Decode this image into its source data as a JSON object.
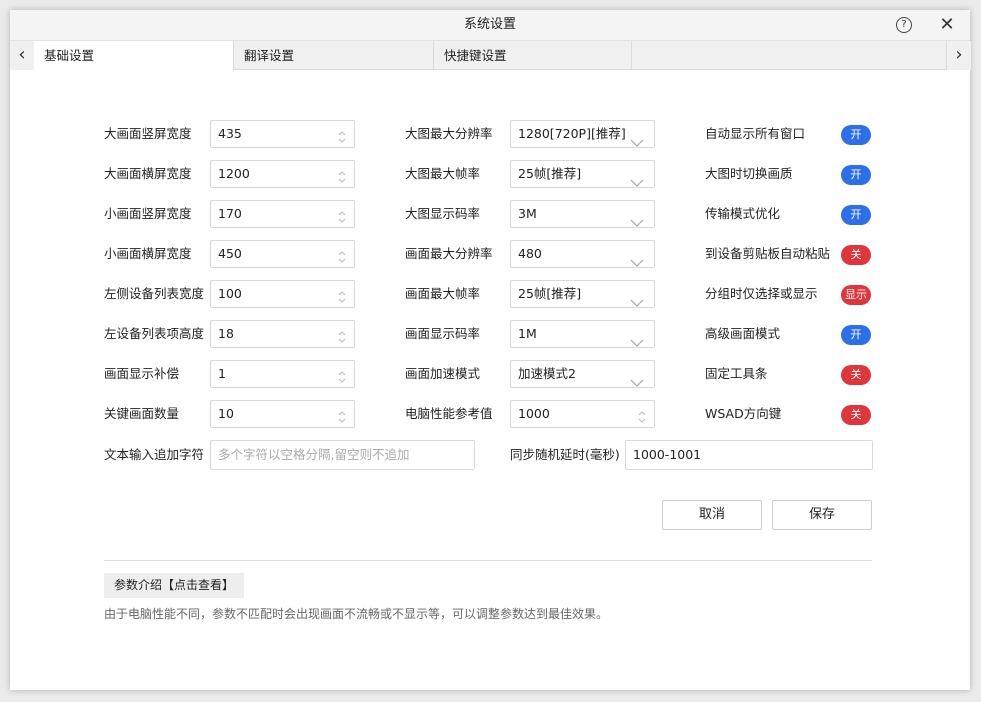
{
  "window": {
    "title": "系统设置",
    "help_label": "?",
    "close_label": "✕"
  },
  "tabs": {
    "prev_arrow": "‹",
    "next_arrow": "›",
    "items": [
      {
        "label": "基础设置",
        "active": true
      },
      {
        "label": "翻译设置",
        "active": false
      },
      {
        "label": "快捷键设置",
        "active": false
      }
    ]
  },
  "col1": [
    {
      "label": "大画面竖屏宽度",
      "value": "435"
    },
    {
      "label": "大画面横屏宽度",
      "value": "1200"
    },
    {
      "label": "小画面竖屏宽度",
      "value": "170"
    },
    {
      "label": "小画面横屏宽度",
      "value": "450"
    },
    {
      "label": "左侧设备列表宽度",
      "value": "100"
    },
    {
      "label": "左设备列表项高度",
      "value": "18"
    },
    {
      "label": "画面显示补偿",
      "value": "1"
    },
    {
      "label": "关键画面数量",
      "value": "10"
    }
  ],
  "col2": [
    {
      "label": "大图最大分辨率",
      "value": "1280[720P][推荐]",
      "control": "dropdown"
    },
    {
      "label": "大图最大帧率",
      "value": "25帧[推荐]",
      "control": "dropdown"
    },
    {
      "label": "大图显示码率",
      "value": "3M",
      "control": "dropdown"
    },
    {
      "label": "画面最大分辨率",
      "value": "480",
      "control": "dropdown"
    },
    {
      "label": "画面最大帧率",
      "value": "25帧[推荐]",
      "control": "dropdown"
    },
    {
      "label": "画面显示码率",
      "value": "1M",
      "control": "dropdown"
    },
    {
      "label": "画面加速模式",
      "value": "加速模式2",
      "control": "dropdown"
    },
    {
      "label": "电脑性能参考值",
      "value": "1000",
      "control": "spin"
    }
  ],
  "col3": [
    {
      "label": "自动显示所有窗口",
      "state": "开",
      "on": true
    },
    {
      "label": "大图时切换画质",
      "state": "开",
      "on": true
    },
    {
      "label": "传输模式优化",
      "state": "开",
      "on": true
    },
    {
      "label": "到设备剪贴板自动粘贴",
      "state": "关",
      "on": false
    },
    {
      "label": "分组时仅选择或显示",
      "state": "显示",
      "on": false
    },
    {
      "label": "高级画面模式",
      "state": "开",
      "on": true
    },
    {
      "label": "固定工具条",
      "state": "关",
      "on": false
    },
    {
      "label": "WSAD方向键",
      "state": "关",
      "on": false
    }
  ],
  "text_append": {
    "label": "文本输入追加字符",
    "value": "",
    "placeholder": "多个字符以空格分隔,留空则不追加"
  },
  "sync_delay": {
    "label": "同步随机延时(毫秒)",
    "value": "1000-1001"
  },
  "actions": {
    "cancel_label": "取消",
    "save_label": "保存"
  },
  "info": {
    "button_label": "参数介绍【点击查看】",
    "description": "由于电脑性能不同，参数不匹配时会出现画面不流畅或不显示等，可以调整参数达到最佳效果。"
  },
  "colors": {
    "toggle_on": "#2d6fe8",
    "toggle_off": "#e0353b"
  }
}
